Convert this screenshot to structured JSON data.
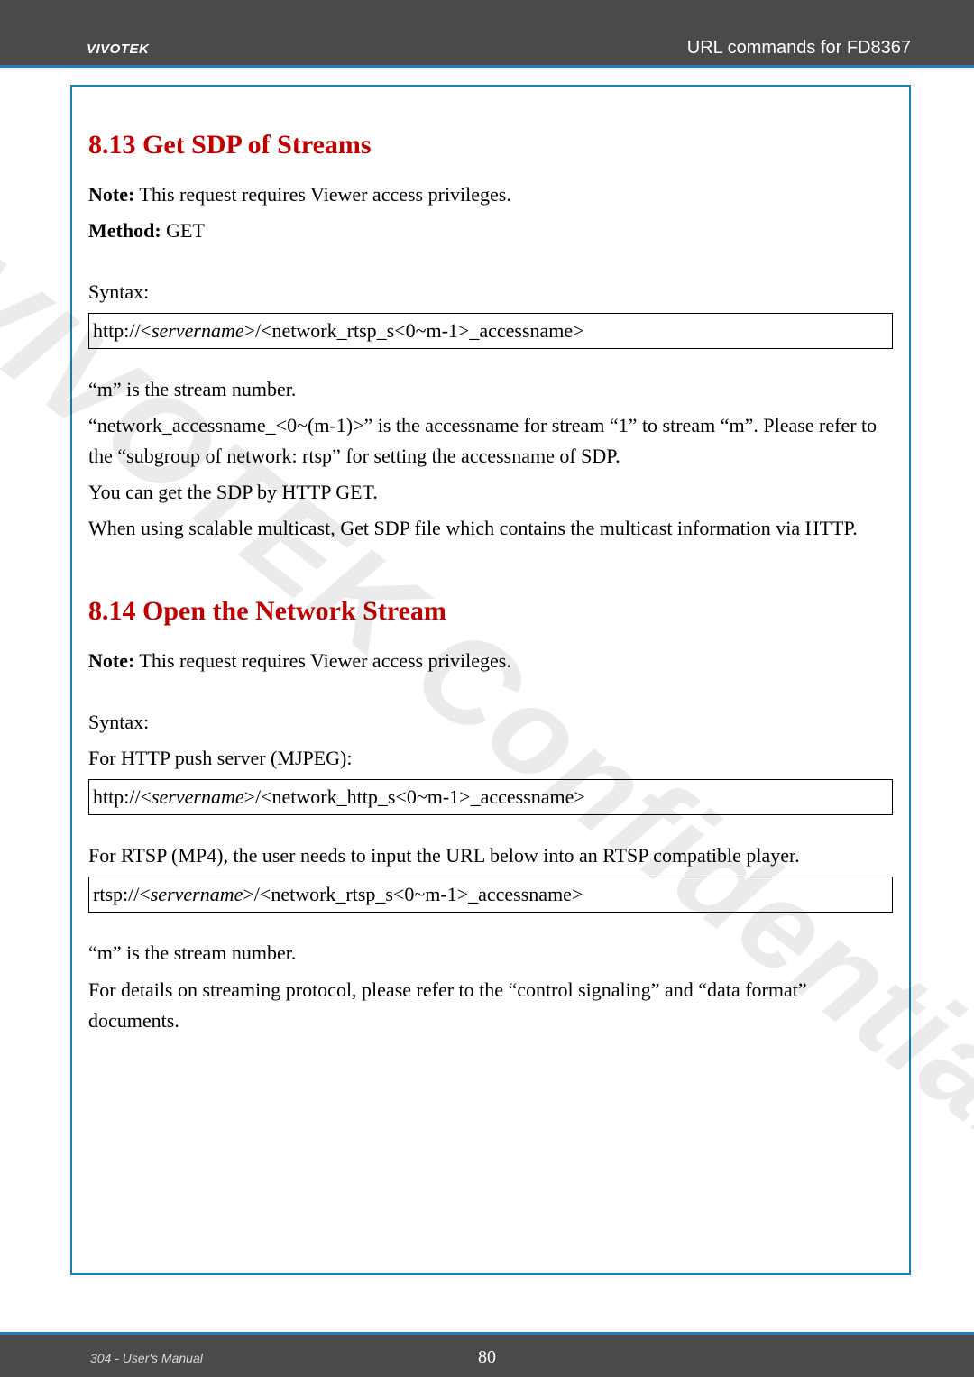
{
  "header": {
    "brand": "VIVOTEK",
    "right": "URL commands for FD8367"
  },
  "watermark": "VIVOTEK Confidential",
  "section1": {
    "heading": "8.13 Get SDP of Streams",
    "note_label": "Note:",
    "note_text": " This request requires Viewer access privileges.",
    "method_label": "Method:",
    "method_text": " GET",
    "syntax_label": "Syntax:",
    "syntax_box_prefix": "http://<",
    "syntax_box_server": "servername",
    "syntax_box_suffix": ">/<network_rtsp_s<0~m-1>_accessname>",
    "p1": "“m” is the stream number.",
    "p2": "“network_accessname_<0~(m-1)>” is the accessname for stream “1” to stream “m”. Please refer to the “subgroup of network: rtsp” for setting the accessname of SDP.",
    "p3": "You can get the SDP by HTTP GET.",
    "p4": "When using scalable multicast, Get SDP file which contains the multicast information via HTTP."
  },
  "section2": {
    "heading": "8.14 Open the Network Stream",
    "note_label": "Note:",
    "note_text": " This request requires Viewer access privileges.",
    "syntax_label": "Syntax:",
    "push_label": "For HTTP push server (MJPEG):",
    "http_box_prefix": "http://<",
    "http_box_server": "servername",
    "http_box_suffix": ">/<network_http_s<0~m-1>_accessname>",
    "rtsp_label": "For RTSP (MP4), the user needs to input the URL below into an RTSP compatible player.",
    "rtsp_box_prefix": "rtsp://<",
    "rtsp_box_server": "servername",
    "rtsp_box_suffix": ">/<network_rtsp_s<0~m-1>_accessname>",
    "p1": "“m” is the stream number.",
    "p2": "For details on streaming protocol, please refer to the “control signaling” and “data format” documents."
  },
  "footer": {
    "left": "304 - User's Manual",
    "center": "80"
  }
}
